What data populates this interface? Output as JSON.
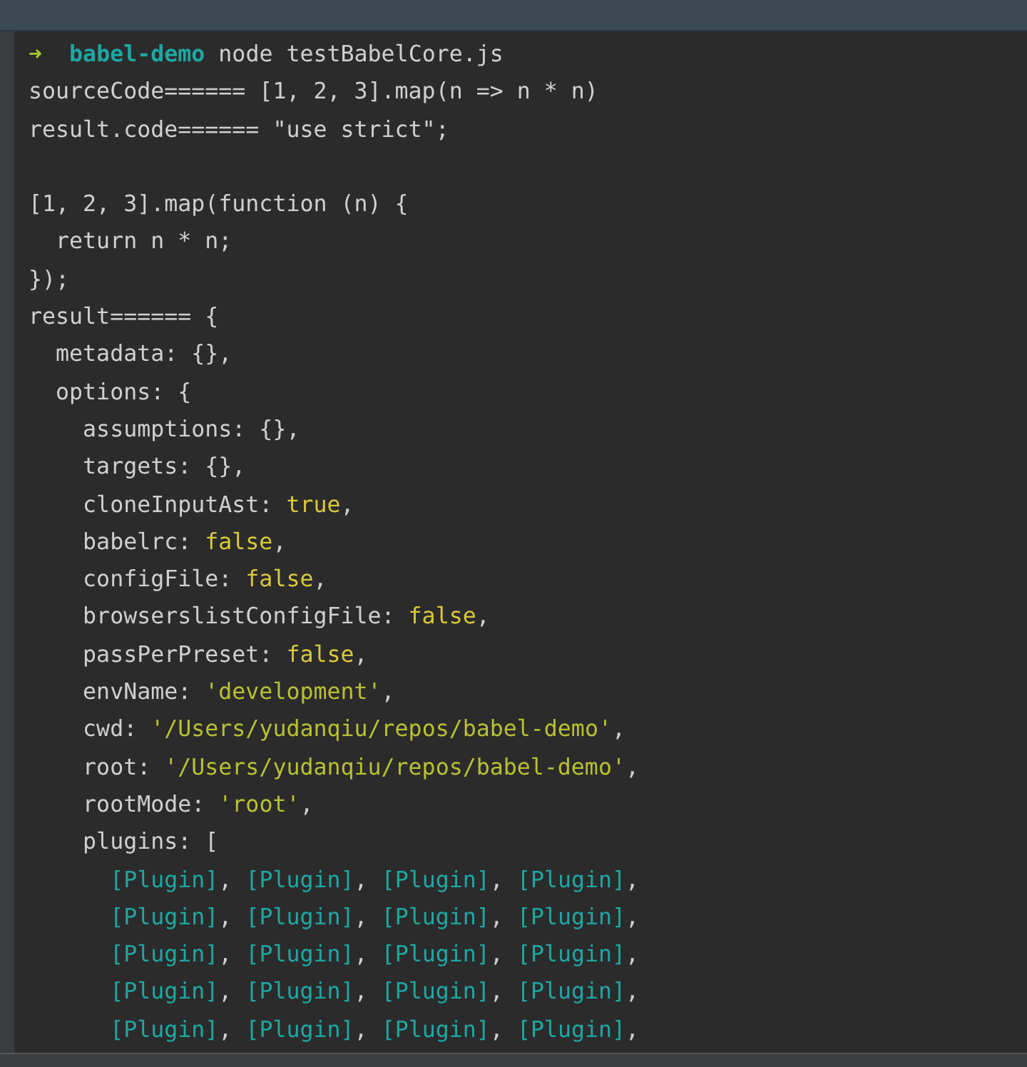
{
  "lines": [
    {
      "kind": "code",
      "segments": [
        {
          "text": "➜  ",
          "kind": "prompt"
        },
        {
          "text": "babel-demo",
          "kind": "dir"
        },
        {
          "text": " node testBabelCore.js",
          "kind": "plain"
        }
      ]
    },
    {
      "kind": "code",
      "segments": [
        {
          "text": "sourceCode====== [1, 2, 3].map(n => n * n)",
          "kind": "plain"
        }
      ]
    },
    {
      "kind": "code",
      "segments": [
        {
          "text": "result.code====== \"use strict\";",
          "kind": "plain"
        }
      ]
    },
    {
      "kind": "blank"
    },
    {
      "kind": "code",
      "segments": [
        {
          "text": "[1, 2, 3].map(function (n) {",
          "kind": "plain"
        }
      ]
    },
    {
      "kind": "code",
      "segments": [
        {
          "text": "  return n * n;",
          "kind": "plain"
        }
      ]
    },
    {
      "kind": "code",
      "segments": [
        {
          "text": "});",
          "kind": "plain"
        }
      ]
    },
    {
      "kind": "code",
      "segments": [
        {
          "text": "result====== {",
          "kind": "plain"
        }
      ]
    },
    {
      "kind": "code",
      "segments": [
        {
          "text": "  metadata: {},",
          "kind": "plain"
        }
      ]
    },
    {
      "kind": "code",
      "segments": [
        {
          "text": "  options: {",
          "kind": "plain"
        }
      ]
    },
    {
      "kind": "code",
      "segments": [
        {
          "text": "    assumptions: {},",
          "kind": "plain"
        }
      ]
    },
    {
      "kind": "code",
      "segments": [
        {
          "text": "    targets: {},",
          "kind": "plain"
        }
      ]
    },
    {
      "kind": "code",
      "segments": [
        {
          "text": "    cloneInputAst: ",
          "kind": "plain"
        },
        {
          "text": "true",
          "kind": "boolean"
        },
        {
          "text": ",",
          "kind": "plain"
        }
      ]
    },
    {
      "kind": "code",
      "segments": [
        {
          "text": "    babelrc: ",
          "kind": "plain"
        },
        {
          "text": "false",
          "kind": "boolean"
        },
        {
          "text": ",",
          "kind": "plain"
        }
      ]
    },
    {
      "kind": "code",
      "segments": [
        {
          "text": "    configFile: ",
          "kind": "plain"
        },
        {
          "text": "false",
          "kind": "boolean"
        },
        {
          "text": ",",
          "kind": "plain"
        }
      ]
    },
    {
      "kind": "code",
      "segments": [
        {
          "text": "    browserslistConfigFile: ",
          "kind": "plain"
        },
        {
          "text": "false",
          "kind": "boolean"
        },
        {
          "text": ",",
          "kind": "plain"
        }
      ]
    },
    {
      "kind": "code",
      "segments": [
        {
          "text": "    passPerPreset: ",
          "kind": "plain"
        },
        {
          "text": "false",
          "kind": "boolean"
        },
        {
          "text": ",",
          "kind": "plain"
        }
      ]
    },
    {
      "kind": "code",
      "segments": [
        {
          "text": "    envName: ",
          "kind": "plain"
        },
        {
          "text": "'development'",
          "kind": "string"
        },
        {
          "text": ",",
          "kind": "plain"
        }
      ]
    },
    {
      "kind": "code",
      "segments": [
        {
          "text": "    cwd: ",
          "kind": "plain"
        },
        {
          "text": "'/Users/yudanqiu/repos/babel-demo'",
          "kind": "string"
        },
        {
          "text": ",",
          "kind": "plain"
        }
      ]
    },
    {
      "kind": "code",
      "segments": [
        {
          "text": "    root: ",
          "kind": "plain"
        },
        {
          "text": "'/Users/yudanqiu/repos/babel-demo'",
          "kind": "string"
        },
        {
          "text": ",",
          "kind": "plain"
        }
      ]
    },
    {
      "kind": "code",
      "segments": [
        {
          "text": "    rootMode: ",
          "kind": "plain"
        },
        {
          "text": "'root'",
          "kind": "string"
        },
        {
          "text": ",",
          "kind": "plain"
        }
      ]
    },
    {
      "kind": "code",
      "segments": [
        {
          "text": "    plugins: [",
          "kind": "plain"
        }
      ]
    },
    {
      "kind": "list_row",
      "segments": [
        {
          "text": "[Plugin]",
          "kind": "special"
        },
        {
          "text": ", ",
          "kind": "plain"
        },
        {
          "text": "[Plugin]",
          "kind": "special"
        },
        {
          "text": ", ",
          "kind": "plain"
        },
        {
          "text": "[Plugin]",
          "kind": "special"
        },
        {
          "text": ", ",
          "kind": "plain"
        },
        {
          "text": "[Plugin]",
          "kind": "special"
        },
        {
          "text": ",",
          "kind": "plain"
        }
      ]
    },
    {
      "kind": "list_row",
      "segments": [
        {
          "text": "[Plugin]",
          "kind": "special"
        },
        {
          "text": ", ",
          "kind": "plain"
        },
        {
          "text": "[Plugin]",
          "kind": "special"
        },
        {
          "text": ", ",
          "kind": "plain"
        },
        {
          "text": "[Plugin]",
          "kind": "special"
        },
        {
          "text": ", ",
          "kind": "plain"
        },
        {
          "text": "[Plugin]",
          "kind": "special"
        },
        {
          "text": ",",
          "kind": "plain"
        }
      ]
    },
    {
      "kind": "list_row",
      "segments": [
        {
          "text": "[Plugin]",
          "kind": "special"
        },
        {
          "text": ", ",
          "kind": "plain"
        },
        {
          "text": "[Plugin]",
          "kind": "special"
        },
        {
          "text": ", ",
          "kind": "plain"
        },
        {
          "text": "[Plugin]",
          "kind": "special"
        },
        {
          "text": ", ",
          "kind": "plain"
        },
        {
          "text": "[Plugin]",
          "kind": "special"
        },
        {
          "text": ",",
          "kind": "plain"
        }
      ]
    },
    {
      "kind": "list_row",
      "segments": [
        {
          "text": "[Plugin]",
          "kind": "special"
        },
        {
          "text": ", ",
          "kind": "plain"
        },
        {
          "text": "[Plugin]",
          "kind": "special"
        },
        {
          "text": ", ",
          "kind": "plain"
        },
        {
          "text": "[Plugin]",
          "kind": "special"
        },
        {
          "text": ", ",
          "kind": "plain"
        },
        {
          "text": "[Plugin]",
          "kind": "special"
        },
        {
          "text": ",",
          "kind": "plain"
        }
      ]
    },
    {
      "kind": "list_row",
      "segments": [
        {
          "text": "[Plugin]",
          "kind": "special"
        },
        {
          "text": ", ",
          "kind": "plain"
        },
        {
          "text": "[Plugin]",
          "kind": "special"
        },
        {
          "text": ", ",
          "kind": "plain"
        },
        {
          "text": "[Plugin]",
          "kind": "special"
        },
        {
          "text": ", ",
          "kind": "plain"
        },
        {
          "text": "[Plugin]",
          "kind": "special"
        },
        {
          "text": ",",
          "kind": "plain"
        }
      ]
    }
  ]
}
